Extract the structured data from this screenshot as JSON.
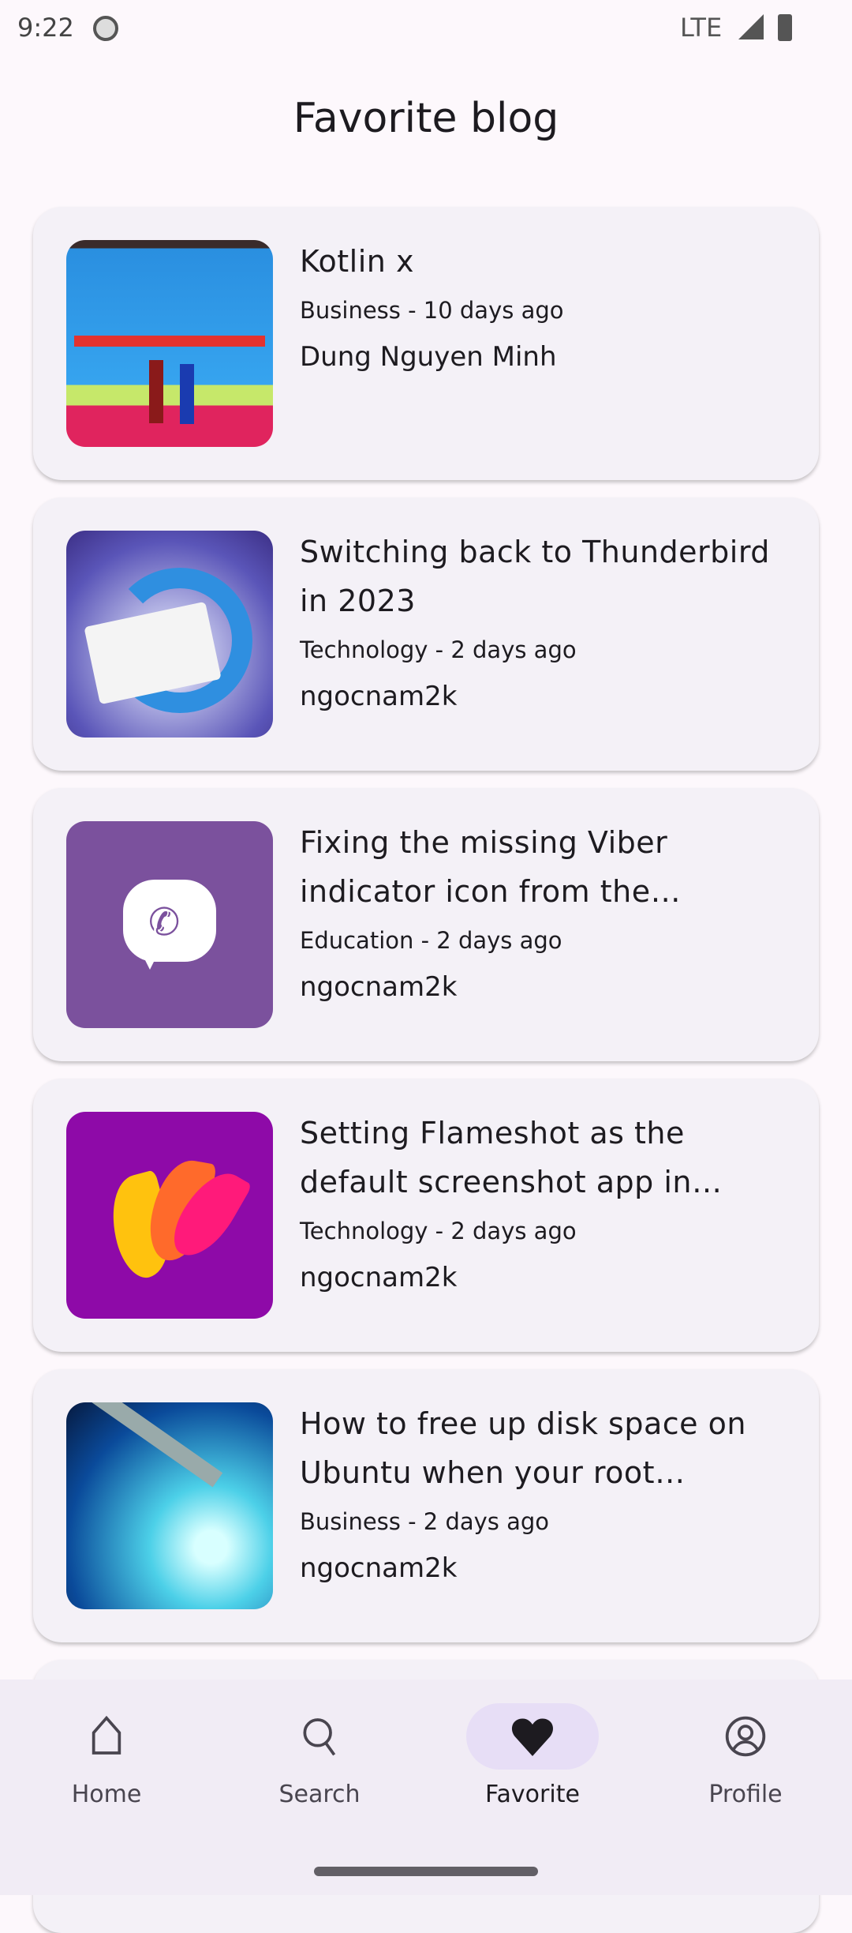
{
  "status_bar": {
    "time": "9:22",
    "network": "LTE"
  },
  "header": {
    "title": "Favorite blog"
  },
  "posts": [
    {
      "title": "Kotlin x",
      "category": "Business",
      "age": "10 days ago",
      "meta": "Business - 10 days ago",
      "author": "Dung Nguyen Minh",
      "thumb": "graduation-photo"
    },
    {
      "title": "Switching back to Thunderbird in 2023",
      "category": "Technology",
      "age": "2 days ago",
      "meta": "Technology - 2 days ago",
      "author": "ngocnam2k",
      "thumb": "thunderbird-logo"
    },
    {
      "title": "Fixing the missing Viber indicator icon from the Cinnamon",
      "category": "Education",
      "age": "2 days ago",
      "meta": "Education - 2 days ago",
      "author": "ngocnam2k",
      "thumb": "viber-logo"
    },
    {
      "title": "Setting Flameshot as the default screenshot app in Ubuntu",
      "category": "Technology",
      "age": "2 days ago",
      "meta": "Technology - 2 days ago",
      "author": "ngocnam2k",
      "thumb": "flameshot-logo"
    },
    {
      "title": "How to free up disk space on Ubuntu when your root partition",
      "category": "Business",
      "age": "2 days ago",
      "meta": "Business - 2 days ago",
      "author": "ngocnam2k",
      "thumb": "hard-disk-photo"
    }
  ],
  "nav": {
    "items": [
      {
        "label": "Home",
        "icon": "home-icon"
      },
      {
        "label": "Search",
        "icon": "search-icon"
      },
      {
        "label": "Favorite",
        "icon": "heart-icon",
        "active": true
      },
      {
        "label": "Profile",
        "icon": "profile-icon"
      }
    ]
  },
  "colors": {
    "active_pill": "#e7def6",
    "nav_bg": "#f1ecf5",
    "card_bg": "#f4f1f7"
  }
}
